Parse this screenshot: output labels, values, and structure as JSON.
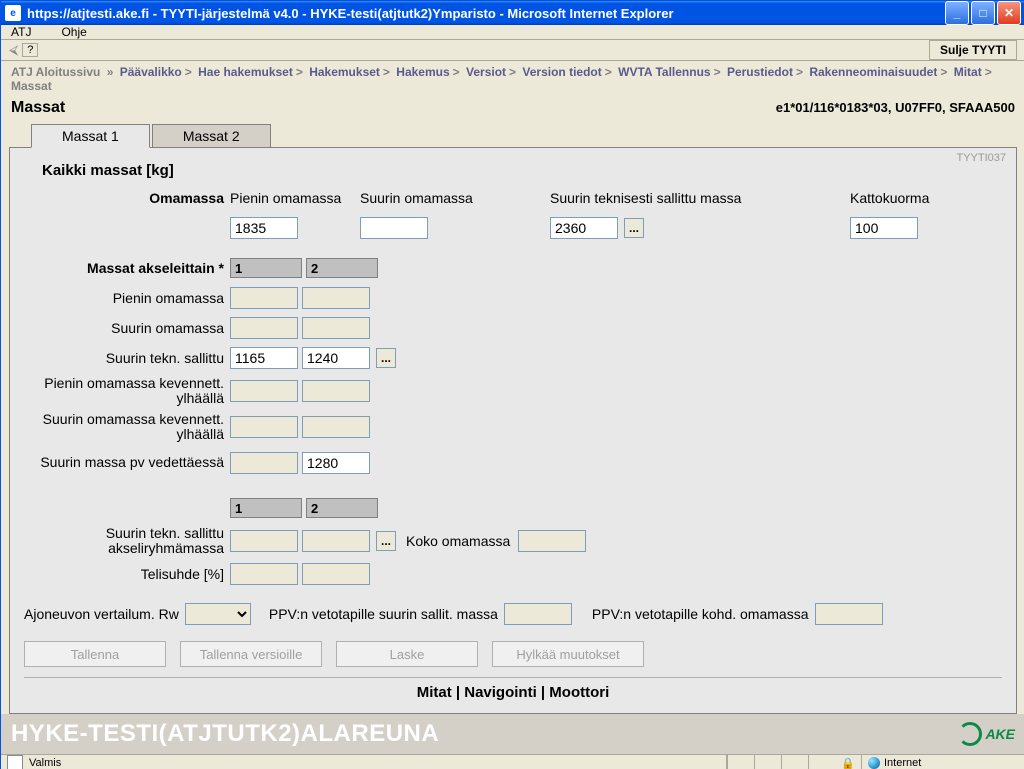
{
  "window": {
    "title": "https://atjtesti.ake.fi - TYYTI-järjestelmä v4.0 - HYKE-testi(atjtutk2)Ymparisto - Microsoft Internet Explorer"
  },
  "menu": {
    "atj": "ATJ",
    "ohje": "Ohje"
  },
  "toolbar": {
    "help": "?",
    "close_btn": "Sulje TYYTI"
  },
  "breadcrumb": {
    "items": [
      "ATJ Aloitussivu",
      "Päävalikko",
      "Hae hakemukset",
      "Hakemukset",
      "Hakemus",
      "Versiot",
      "Version tiedot",
      "WVTA Tallennus",
      "Perustiedot",
      "Rakenneominaisuudet",
      "Mitat"
    ],
    "current": "Massat",
    "first_sep": "»",
    "sep": ">"
  },
  "header": {
    "title": "Massat",
    "code": "e1*01/116*0183*03, U07FF0, SFAAA500"
  },
  "tabs": {
    "t1": "Massat 1",
    "t2": "Massat 2"
  },
  "panel_code": "TYYTI037",
  "section1": {
    "title": "Kaikki massat [kg]",
    "omamassa_label": "Omamassa",
    "pienin_label": "Pienin omamassa",
    "suurin_label": "Suurin omamassa",
    "tekn_label": "Suurin teknisesti sallittu massa",
    "katto_label": "Kattokuorma",
    "pienin_val": "1835",
    "suurin_val": "",
    "tekn_val": "2360",
    "katto_val": "100"
  },
  "axles": {
    "title": "Massat akseleittain",
    "star": "*",
    "col1": "1",
    "col2": "2",
    "rows": {
      "pienin": {
        "label": "Pienin omamassa",
        "v1": "",
        "v2": ""
      },
      "suurin": {
        "label": "Suurin omamassa",
        "v1": "",
        "v2": ""
      },
      "tekn": {
        "label": "Suurin tekn. sallittu",
        "v1": "1165",
        "v2": "1240"
      },
      "pk": {
        "label": "Pienin omamassa kevennett. ylhäällä",
        "v1": "",
        "v2": ""
      },
      "sk": {
        "label": "Suurin omamassa kevennett. ylhäällä",
        "v1": "",
        "v2": ""
      },
      "pv": {
        "label": "Suurin massa pv vedettäessä",
        "v1": "",
        "v2": "1280"
      }
    }
  },
  "axlegroup": {
    "col1": "1",
    "col2": "2",
    "ryhma": {
      "label": "Suurin tekn. sallittu akseliryhmämassa",
      "v1": "",
      "v2": ""
    },
    "koko_label": "Koko omamassa",
    "koko_val": "",
    "teli": {
      "label": "Telisuhde [%]",
      "v1": "",
      "v2": ""
    }
  },
  "bottom": {
    "rw_label": "Ajoneuvon vertailum. Rw",
    "ppv1_label": "PPV:n vetotapille suurin sallit. massa",
    "ppv1_val": "",
    "ppv2_label": "PPV:n vetotapille kohd. omamassa",
    "ppv2_val": ""
  },
  "buttons": {
    "save": "Tallenna",
    "save_versions": "Tallenna versioille",
    "calc": "Laske",
    "reject": "Hylkää muutokset"
  },
  "navlinks": "Mitat | Navigointi | Moottori",
  "env_footer": "HYKE-TESTI(ATJTUTK2)ALAREUNA",
  "ake": "AKE",
  "status": {
    "ready": "Valmis",
    "zone": "Internet"
  },
  "dots": "..."
}
